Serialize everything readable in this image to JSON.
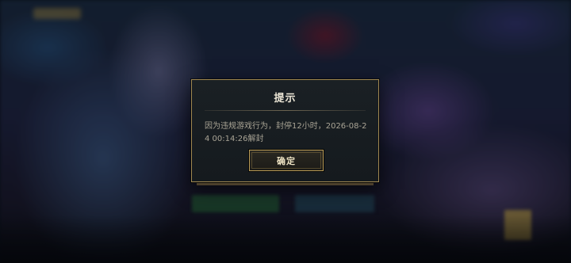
{
  "dialog": {
    "title": "提示",
    "message": "因为违规游戏行为，封停12小时，2026-08-24 00:14:26解封",
    "confirm_label": "确定"
  },
  "colors": {
    "frame_gold": "#a08850",
    "button_gold": "#b89a55",
    "title_text": "#ece6d6",
    "message_text": "#a9a495",
    "panel_bg": "#171c20"
  }
}
